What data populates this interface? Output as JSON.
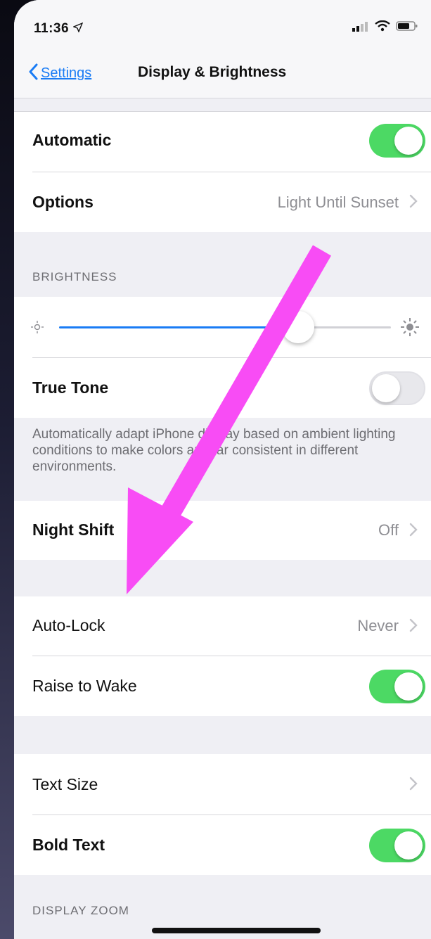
{
  "status_bar": {
    "time": "11:36",
    "icons": [
      "location-arrow-icon",
      "signal-icon",
      "wifi-icon",
      "battery-icon"
    ]
  },
  "nav": {
    "back_label": "Settings",
    "title": "Display & Brightness"
  },
  "appearance": {
    "automatic_label": "Automatic",
    "automatic_on": true,
    "options_label": "Options",
    "options_value": "Light Until Sunset"
  },
  "brightness": {
    "header": "BRIGHTNESS",
    "level": 0.72,
    "true_tone_label": "True Tone",
    "true_tone_on": false,
    "true_tone_footer": "Automatically adapt iPhone display based on ambient lighting conditions to make colors appear consistent in different environments."
  },
  "night_shift": {
    "label": "Night Shift",
    "value": "Off"
  },
  "lock": {
    "auto_lock_label": "Auto-Lock",
    "auto_lock_value": "Never",
    "raise_to_wake_label": "Raise to Wake",
    "raise_to_wake_on": true
  },
  "text": {
    "text_size_label": "Text Size",
    "bold_text_label": "Bold Text",
    "bold_text_on": true
  },
  "display_zoom": {
    "header": "DISPLAY ZOOM"
  },
  "colors": {
    "accent": "#1a7cf5",
    "toggle_on": "#4cd964",
    "annotation_arrow": "#f84cf5"
  }
}
